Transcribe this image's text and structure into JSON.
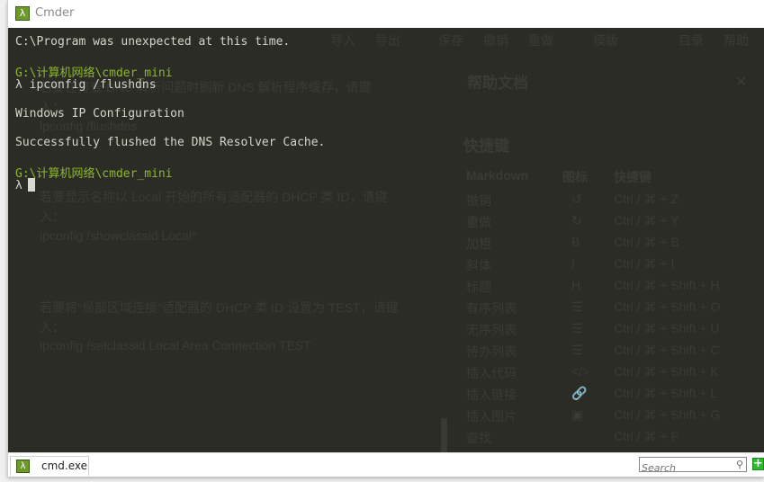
{
  "window": {
    "title": "Cmder"
  },
  "background_toolbar": [
    "导入",
    "导出",
    "保存",
    "撤销",
    "重做",
    "模版",
    "目录",
    "帮助"
  ],
  "background_help": {
    "title": "帮助文档",
    "section": "快捷键",
    "headers": [
      "Markdown",
      "图标",
      "快捷键"
    ],
    "rows": [
      [
        "撤销",
        "↺",
        "Ctrl / ⌘ + Z"
      ],
      [
        "重做",
        "↻",
        "Ctrl / ⌘ + Y"
      ],
      [
        "加粗",
        "B",
        "Ctrl / ⌘ + B"
      ],
      [
        "斜体",
        "I",
        "Ctrl / ⌘ + I"
      ],
      [
        "标题",
        "H",
        "Ctrl / ⌘ + Shift + H"
      ],
      [
        "有序列表",
        "☰",
        "Ctrl / ⌘ + Shift + O"
      ],
      [
        "无序列表",
        "☰",
        "Ctrl / ⌘ + Shift + U"
      ],
      [
        "待办列表",
        "☰",
        "Ctrl / ⌘ + Shift + C"
      ],
      [
        "插入代码",
        "</>",
        "Ctrl / ⌘ + Shift + K"
      ],
      [
        "插入链接",
        "🔗",
        "Ctrl / ⌘ + Shift + L"
      ],
      [
        "插入图片",
        "▣",
        "Ctrl / ⌘ + Shift + G"
      ],
      [
        "查找",
        "",
        "Ctrl / ⌘ + F"
      ],
      [
        "替换",
        "",
        "Ctrl / ⌘ + G"
      ]
    ]
  },
  "background_doc": [
    "若要在排查 DNS 解析问题时刷新 DNS 解析程序缓存，请键",
    "入：",
    "ipconfig /flushdns",
    "若要显示名称以 Local 开始的所有适配器的 DHCP 类 ID，请键",
    "入：",
    "ipconfig /showclassid Local*",
    "若要将\"局部区域连接\"适配器的 DHCP 类 ID 设置为 TEST，请键",
    "入：",
    "ipconfig /setclassid Local Area Connection TEST"
  ],
  "terminal": {
    "lines": [
      {
        "text": "C:\\Program was unexpected at this time.",
        "type": "output"
      },
      {
        "text": "G:\\计算机网络\\cmder_mini",
        "type": "path"
      },
      {
        "text": "λ ipconfig /flushdns",
        "type": "command"
      },
      {
        "text": "Windows IP Configuration",
        "type": "output"
      },
      {
        "text": "Successfully flushed the DNS Resolver Cache.",
        "type": "output"
      },
      {
        "text": "G:\\计算机网络\\cmder_mini",
        "type": "path"
      },
      {
        "text": "λ",
        "type": "prompt"
      }
    ]
  },
  "status": {
    "tab_label": "cmd.exe",
    "search_placeholder": "Search"
  },
  "colors": {
    "terminal_bg": "#2c2c27",
    "path": "#8ab82d",
    "text": "#d4d4c8",
    "accent_green": "#2dbb2d"
  }
}
